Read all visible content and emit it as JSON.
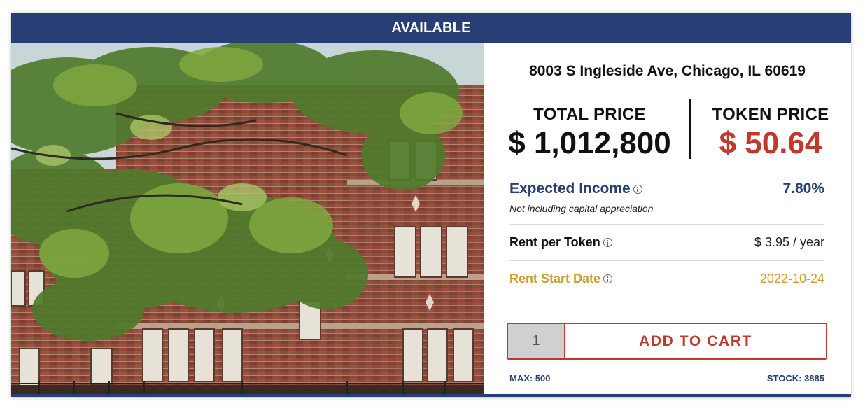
{
  "status_banner": "AVAILABLE",
  "property": {
    "address": "8003 S Ingleside Ave, Chicago, IL 60619"
  },
  "pricing": {
    "total_label": "TOTAL PRICE",
    "total_value": "$ 1,012,800",
    "token_label": "TOKEN PRICE",
    "token_value": "$ 50.64"
  },
  "metrics": {
    "expected_income_label": "Expected Income",
    "expected_income_value": "7.80%",
    "expected_income_note": "Not including capital appreciation",
    "rent_per_token_label": "Rent per Token",
    "rent_per_token_value": "$ 3.95 / year",
    "rent_start_label": "Rent Start Date",
    "rent_start_value": "2022-10-24"
  },
  "cart": {
    "quantity": "1",
    "add_label": "ADD TO CART",
    "max_text": "MAX: 500",
    "stock_text": "STOCK: 3885"
  },
  "colors": {
    "navy": "#273f75",
    "red": "#c0392b",
    "gold": "#d29d2c"
  },
  "icons": {
    "info": "info-circle-icon"
  }
}
